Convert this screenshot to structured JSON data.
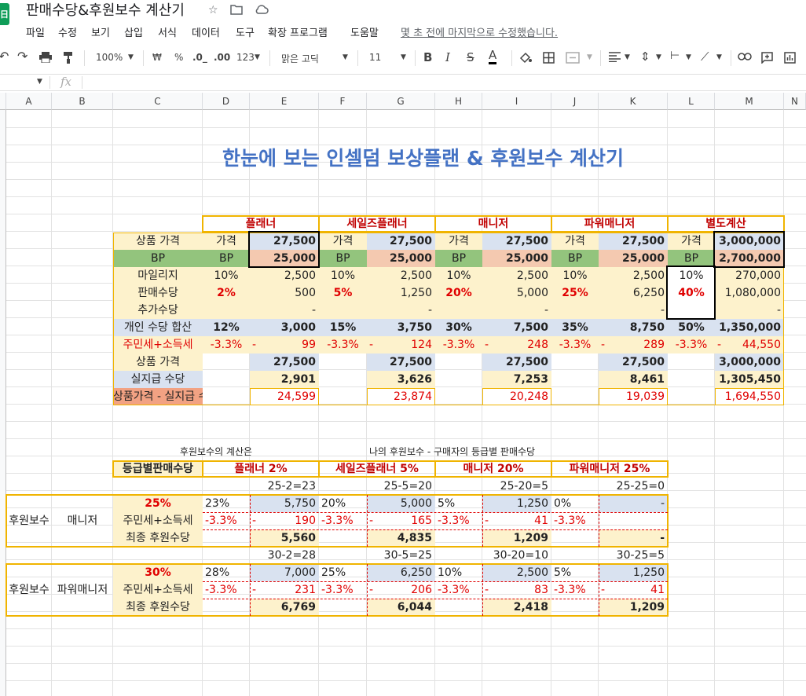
{
  "app": {
    "title": "판매수당&후원보수 계산기",
    "logo_letter": "日",
    "last_edit": "몇 초 전에 마지막으로 수정했습니다."
  },
  "menu": [
    "파일",
    "수정",
    "보기",
    "삽입",
    "서식",
    "데이터",
    "도구",
    "확장 프로그램",
    "도움말"
  ],
  "toolbar": {
    "zoom": "100%",
    "currency": "₩",
    "percent": "%",
    "dec_less": ".0_",
    "dec_more": ".00",
    "number_format": "123",
    "font": "맑은 고딕",
    "font_size": "11"
  },
  "formula_bar": {
    "fx": "fx",
    "value": ""
  },
  "columns": [
    "A",
    "B",
    "C",
    "D",
    "E",
    "F",
    "G",
    "H",
    "I",
    "J",
    "K",
    "L",
    "M"
  ],
  "sheet": {
    "title": "한눈에 보는 인셀덤 보상플랜 & 후원보수 계산기",
    "levels": [
      "플래너",
      "세일즈플래너",
      "매니저",
      "파워매니저",
      "별도계산"
    ],
    "row_labels": [
      "상품 가격",
      "BP",
      "마일리지",
      "판매수당",
      "추가수당",
      "개인 수당 합산",
      "주민세+소득세",
      "상품 가격",
      "실지급 수당",
      "상품가격 - 실지급 수당"
    ],
    "price_row": [
      "가격",
      "27,500",
      "가격",
      "27,500",
      "가격",
      "27,500",
      "가격",
      "27,500",
      "가격",
      "3,000,000"
    ],
    "bp_row": [
      "BP",
      "25,000",
      "BP",
      "25,000",
      "BP",
      "25,000",
      "BP",
      "25,000",
      "BP",
      "2,700,000"
    ],
    "mileage_row": [
      "10%",
      "2,500",
      "10%",
      "2,500",
      "10%",
      "2,500",
      "10%",
      "2,500",
      "10%",
      "270,000"
    ],
    "sales_row": [
      "2%",
      "500",
      "5%",
      "1,250",
      "20%",
      "5,000",
      "25%",
      "6,250",
      "40%",
      "1,080,000"
    ],
    "extra_row": [
      "",
      "-",
      "",
      "-",
      "",
      "-",
      "",
      "-",
      "",
      "-"
    ],
    "sum_row": [
      "12%",
      "3,000",
      "15%",
      "3,750",
      "30%",
      "7,500",
      "35%",
      "8,750",
      "50%",
      "1,350,000"
    ],
    "tax_row": [
      "-3.3%",
      "-",
      "99",
      "-3.3%",
      "-",
      "124",
      "-3.3%",
      "-",
      "248",
      "-3.3%",
      "-",
      "289",
      "-3.3%",
      "-",
      "44,550"
    ],
    "price2_row": [
      "27,500",
      "27,500",
      "27,500",
      "27,500",
      "3,000,000"
    ],
    "net_row": [
      "2,901",
      "3,626",
      "7,253",
      "8,461",
      "1,305,450"
    ],
    "diff_row": [
      "24,599",
      "23,874",
      "20,248",
      "19,039",
      "1,694,550"
    ],
    "note1": "후원보수의 계산은",
    "note2": "나의 후원보수 - 구매자의 등급별 판매수당",
    "grade_header": "등급별판매수당",
    "grade_levels": [
      "플래너 2%",
      "세일즈플래너 5%",
      "매니저 20%",
      "파워매니저 25%"
    ],
    "manager": {
      "diffs": [
        "25-2=23",
        "25-5=20",
        "25-20=5",
        "25-25=0"
      ],
      "label_a": "후원보수",
      "label_b": "매니저",
      "rate": "25%",
      "row1": [
        "23%",
        "5,750",
        "20%",
        "5,000",
        "5%",
        "1,250",
        "0%",
        "-"
      ],
      "tax_label": "주민세+소득세",
      "row2": [
        "-3.3%",
        "-",
        "190",
        "-3.3%",
        "-",
        "165",
        "-3.3%",
        "-",
        "41",
        "-3.3%"
      ],
      "final_label": "최종 후원수당",
      "row3": [
        "5,560",
        "4,835",
        "1,209",
        "-"
      ]
    },
    "power": {
      "diffs": [
        "30-2=28",
        "30-5=25",
        "30-20=10",
        "30-25=5"
      ],
      "label_a": "후원보수",
      "label_b": "파워매니저",
      "rate": "30%",
      "row1": [
        "28%",
        "7,000",
        "25%",
        "6,250",
        "10%",
        "2,500",
        "5%",
        "1,250"
      ],
      "tax_label": "주민세+소득세",
      "row2": [
        "-3.3%",
        "-",
        "231",
        "-3.3%",
        "-",
        "206",
        "-3.3%",
        "-",
        "83",
        "-3.3%",
        "-",
        "41"
      ],
      "final_label": "최종 후원수당",
      "row3": [
        "6,769",
        "6,044",
        "2,418",
        "1,209"
      ]
    }
  }
}
